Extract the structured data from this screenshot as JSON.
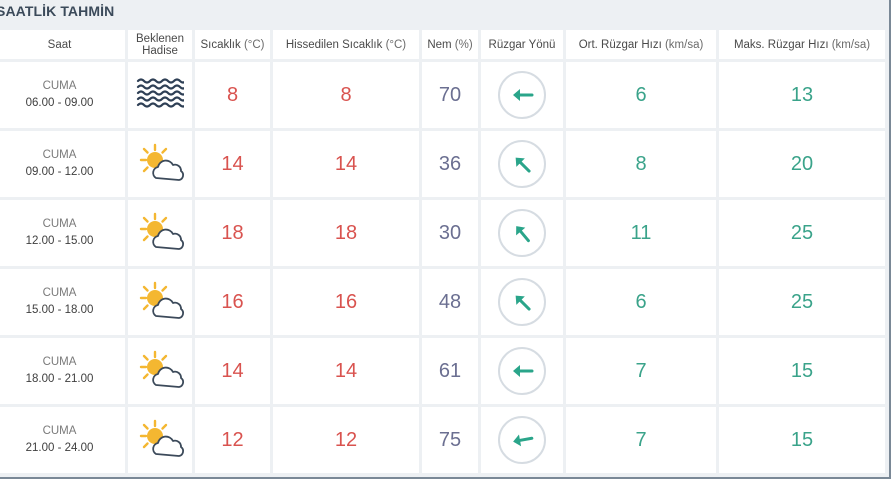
{
  "title": "SAATLİK TAHMİN",
  "headers": {
    "saat": "Saat",
    "hadise_line1": "Beklenen",
    "hadise_line2": "Hadise",
    "sicaklik": "Sıcaklık",
    "sicaklik_unit": "(°C)",
    "hissedilen": "Hissedilen Sıcaklık",
    "hissedilen_unit": "(°C)",
    "nem": "Nem",
    "nem_unit": "(%)",
    "ruzgar_yonu": "Rüzgar Yönü",
    "ort_ruzgar": "Ort. Rüzgar Hızı",
    "ort_ruzgar_unit": "(km/sa)",
    "maks_ruzgar": "Maks. Rüzgar Hızı",
    "maks_ruzgar_unit": "(km/sa)"
  },
  "rows": [
    {
      "day": "CUMA",
      "time": "06.00 - 09.00",
      "icon": "fog-icon",
      "temp": "8",
      "feels": "8",
      "humidity": "70",
      "wind_dir_deg": 270,
      "wind_avg": "6",
      "wind_max": "13"
    },
    {
      "day": "CUMA",
      "time": "09.00 - 12.00",
      "icon": "partly-cloudy-icon",
      "temp": "14",
      "feels": "14",
      "humidity": "36",
      "wind_dir_deg": 315,
      "wind_avg": "8",
      "wind_max": "20"
    },
    {
      "day": "CUMA",
      "time": "12.00 - 15.00",
      "icon": "partly-cloudy-icon",
      "temp": "18",
      "feels": "18",
      "humidity": "30",
      "wind_dir_deg": 320,
      "wind_avg": "11",
      "wind_max": "25"
    },
    {
      "day": "CUMA",
      "time": "15.00 - 18.00",
      "icon": "partly-cloudy-icon",
      "temp": "16",
      "feels": "16",
      "humidity": "48",
      "wind_dir_deg": 315,
      "wind_avg": "6",
      "wind_max": "25"
    },
    {
      "day": "CUMA",
      "time": "18.00 - 21.00",
      "icon": "partly-cloudy-icon",
      "temp": "14",
      "feels": "14",
      "humidity": "61",
      "wind_dir_deg": 270,
      "wind_avg": "7",
      "wind_max": "15"
    },
    {
      "day": "CUMA",
      "time": "21.00 - 24.00",
      "icon": "partly-cloudy-icon",
      "temp": "12",
      "feels": "12",
      "humidity": "75",
      "wind_dir_deg": 260,
      "wind_avg": "7",
      "wind_max": "15"
    }
  ],
  "colors": {
    "temp": "#d9534f",
    "humidity": "#6b6f91",
    "wind": "#3aa38a",
    "arrow": "#2aa58a",
    "sun": "#f4b731",
    "fog": "#2e3f55"
  }
}
